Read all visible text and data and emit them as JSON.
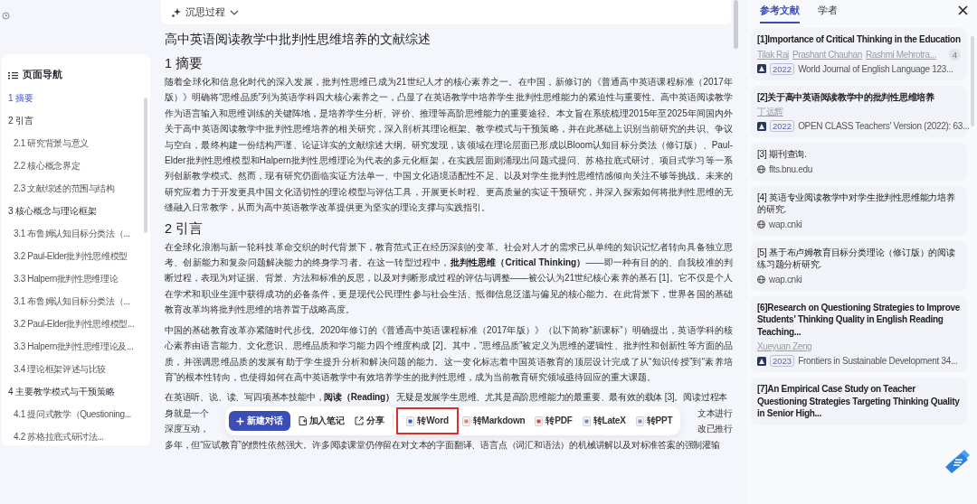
{
  "header": {
    "title": "沉思过程"
  },
  "nav": {
    "title": "页面导航",
    "items": [
      {
        "label": "1 摘要",
        "selected": true
      },
      {
        "label": "2 引言",
        "selected": false,
        "children": [
          {
            "label": "2.1 研究背景与意义",
            "selected": false
          },
          {
            "label": "2.2 核心概念界定",
            "selected": false
          },
          {
            "label": "2.3 文献综述的范围与结构",
            "selected": false
          }
        ]
      },
      {
        "label": "3 核心概念与理论框架",
        "selected": false,
        "children": [
          {
            "label": "3.1 布鲁姆认知目标分类法（...",
            "selected": false
          },
          {
            "label": "3.2 Paul-Elder批判性思维模型",
            "selected": false
          },
          {
            "label": "3.3 Halpern批判性思维理论",
            "selected": false
          },
          {
            "label": "3.1 布鲁姆认知目标分类法（...",
            "selected": false
          },
          {
            "label": "3.2 Paul-Elder批判性思维模型...",
            "selected": false
          },
          {
            "label": "3.3 Halpern批判性思维理论及...",
            "selected": false
          },
          {
            "label": "3.4 理论框架评述与比较",
            "selected": false
          }
        ]
      },
      {
        "label": "4 主要教学模式与干预策略",
        "selected": false,
        "children": [
          {
            "label": "4.1 提问式教学（Questioning...",
            "selected": false
          },
          {
            "label": "4.2 苏格拉底式研讨法...",
            "selected": false
          }
        ]
      }
    ]
  },
  "doc": {
    "title": "高中英语阅读教学中批判性思维培养的文献综述",
    "sections": [
      {
        "heading": "1 摘要",
        "paragraphs": [
          "随着全球化和信息化时代的深入发展，批判性思维已成为21世纪人才的核心素养之一。在中国，新修订的《普通高中英语课程标准（2017年版）》明确将“思维品质”列为英语学科四大核心素养之一，凸显了在英语教学中培养学生批判性思维能力的紧迫性与重要性。高中英语阅读教学作为语言输入和思维训练的关键阵地，是培养学生分析、评价、推理等高阶思维能力的重要途径。本文旨在系统梳理2015年至2025年间国内外关于高中英语阅读教学中批判性思维培养的相关研究，深入剖析其理论框架、教学模式与干预策略，并在此基础上识别当前研究的共识、争议与空白，最终构建一份结构严谨、论证详实的文献综述大纲。研究发现，该领域在理论层面已形成以Bloom认知目标分类法（修订版）、Paul-Elder批判性思维模型和Halpern批判性思维理论为代表的多元化框架，在实践层面则涌现出问题式提问、苏格拉底式研讨、项目式学习等一系列创新教学模式。然而，现有研究仍面临实证方法单一、中国文化语境适配性不足、以及对学生批判性思维情感倾向关注不够等挑战。未来的研究应着力于开发更具中国文化适切性的理论模型与评估工具，开展更长时程、更高质量的实证干预研究，并深入探索如何将批判性思维的无缝融入日常教学，从而为高中英语教学改革提供更为坚实的理论支撑与实践指引。"
        ]
      },
      {
        "heading": "2 引言",
        "paragraphs": [
          "在全球化浪潮与新一轮科技革命交织的时代背景下，教育范式正在经历深刻的变革。社会对人才的需求已从单纯的知识记忆者转向具备独立思考、创新能力和复杂问题解决能力的终身学习者。在这一转型过程中，**批判性思维（Critical Thinking）**——即一种有目的的、自我校准的判断过程，表现为对证据、背景、方法和标准的反思，以及对判断形成过程的评估与调整——被公认为21世纪核心素养的基石 [1]。它不仅是个人在学术和职业生涯中获得成功的必备条件，更是现代公民理性参与社会生活、抵御信息泛滥与偏见的核心能力。在此背景下，世界各国的基础教育改革均将批判性思维的培养置于战略高度。",
          "中国的基础教育改革亦紧随时代步伐。2020年修订的《普通高中英语课程标准（2017年版）》（以下简称“新课标”）明确提出，英语学科的核心素养由语言能力、文化意识、思维品质和学习能力四个维度构成 [2]。其中，“思维品质”被定义为思维的逻辑性、批判性和创新性等方面的品质，并强调思维品质的发展有助于学生提升分析和解决问题的能力。这一变化标志着中国英语教育的顶层设计完成了从“知识传授”到“素养培育”的根本性转向，也使得如何在高中英语教学中有效培养学生的批判性思维，成为当前教育研究领域亟待回应的重大课题。"
        ],
        "partial_lines": [
          {
            "left": "在英语听、说、读、写四项基本技能中，**阅读（Reading）** 无疑是发展学生思维、尤其是高阶思维能力的最重要、最有效的载体 [3]。阅读过程本"
          },
          {
            "left": "身就是一个",
            "right": "文本进行"
          },
          {
            "left": "深度互动，",
            "right": "改已推行"
          },
          {
            "left": "多年，但“应试教育”的惯性依然强大。许多阅读课堂仍停留在对文本的字面翻译、语言点（词汇和语法）的机械讲解以及对标准答案的强制灌输"
          }
        ]
      }
    ]
  },
  "toolbar": {
    "buttons": [
      {
        "kind": "primary",
        "label": "新建对话",
        "highlighted": false
      },
      {
        "kind": "note",
        "label": "加入笔记",
        "highlighted": false
      },
      {
        "kind": "share",
        "label": "分享",
        "highlighted": false
      },
      {
        "kind": "word",
        "label": "转Word",
        "highlighted": true
      },
      {
        "kind": "markdown",
        "label": "转Markdown",
        "highlighted": false
      },
      {
        "kind": "pdf",
        "label": "转PDF",
        "highlighted": false
      },
      {
        "kind": "latex",
        "label": "转LateX",
        "highlighted": false
      },
      {
        "kind": "ppt",
        "label": "转PPT",
        "highlighted": false
      }
    ]
  },
  "refs": {
    "tabs": [
      {
        "label": "参考文献",
        "selected": true
      },
      {
        "label": "学者",
        "selected": false
      }
    ],
    "cards": [
      {
        "kind": "paper",
        "title": "[1]Importance of Critical Thinking in the Education",
        "authors": [
          "Tilak Raj",
          "Prashant Chauhan",
          "Rashmi Mehrotra..."
        ],
        "count": "4",
        "year": "2022",
        "venue": "World Journal of English Language 123..."
      },
      {
        "kind": "paper",
        "title": "[2]关于高中英语阅读教学中的批判性思维培养",
        "authors": [
          "丁远辉"
        ],
        "year": "2022",
        "venue": "OPEN CLASS Teachers' Version (2022): 63..."
      },
      {
        "kind": "web",
        "title": "[3] 期刊查询.",
        "site": "flts.bnu.edu"
      },
      {
        "kind": "web",
        "title": "[4] 英语专业阅读教学中对学生批判性思维能力培养的研究.",
        "site": "wap.cnki"
      },
      {
        "kind": "web",
        "title": "[5] 基于布卢姆教育目标分类理论（修订版）的阅读练习题分析研究.",
        "site": "wap.cnki"
      },
      {
        "kind": "paper",
        "title": "[6]Research on Questioning Strategies to Improve Students' Thinking Quality in English Reading Teaching...",
        "authors": [
          "Xueyuan Zeng"
        ],
        "year": "2023",
        "venue": "Frontiers in Sustainable Development 34..."
      },
      {
        "kind": "paper",
        "title": "[7]An Empirical Case Study on Teacher Questioning Strategies Targeting Thinking Quality in Senior High..."
      }
    ]
  }
}
